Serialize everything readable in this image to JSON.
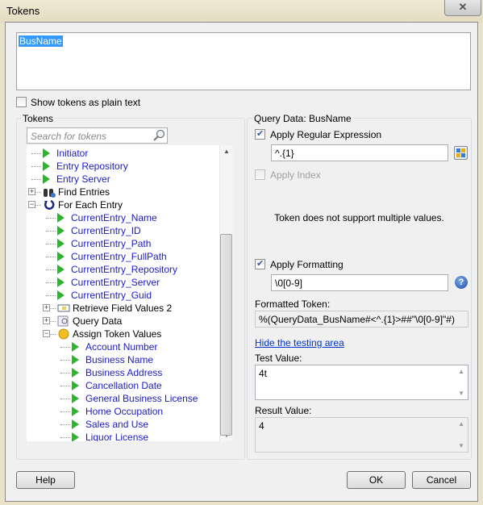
{
  "window": {
    "title": "Tokens",
    "close_icon": "close-icon"
  },
  "editor": {
    "value": "BusName"
  },
  "plain_text": {
    "label": "Show tokens as plain text",
    "checked": false
  },
  "tokens_panel": {
    "title": "Tokens",
    "search_placeholder": "Search for tokens",
    "tree": [
      {
        "label": "Initiator",
        "level": 1,
        "type": "token"
      },
      {
        "label": "Entry Repository",
        "level": 1,
        "type": "token"
      },
      {
        "label": "Entry Server",
        "level": 1,
        "type": "token"
      },
      {
        "label": "Find Entries",
        "level": 1,
        "type": "node",
        "icon": "binoculars-icon",
        "expanded": false
      },
      {
        "label": "For Each Entry",
        "level": 1,
        "type": "node",
        "icon": "loop-icon",
        "expanded": true
      },
      {
        "label": "CurrentEntry_Name",
        "level": 2,
        "type": "token"
      },
      {
        "label": "CurrentEntry_ID",
        "level": 2,
        "type": "token"
      },
      {
        "label": "CurrentEntry_Path",
        "level": 2,
        "type": "token"
      },
      {
        "label": "CurrentEntry_FullPath",
        "level": 2,
        "type": "token"
      },
      {
        "label": "CurrentEntry_Repository",
        "level": 2,
        "type": "token"
      },
      {
        "label": "CurrentEntry_Server",
        "level": 2,
        "type": "token"
      },
      {
        "label": "CurrentEntry_Guid",
        "level": 2,
        "type": "token"
      },
      {
        "label": "Retrieve Field Values 2",
        "level": 2,
        "type": "node",
        "icon": "field-values-icon",
        "expanded": false
      },
      {
        "label": "Query Data",
        "level": 2,
        "type": "node",
        "icon": "query-icon",
        "expanded": false
      },
      {
        "label": "Assign Token Values",
        "level": 2,
        "type": "node",
        "icon": "coin-icon",
        "expanded": true
      },
      {
        "label": "Account Number",
        "level": 3,
        "type": "token"
      },
      {
        "label": "Business Name",
        "level": 3,
        "type": "token"
      },
      {
        "label": "Business Address",
        "level": 3,
        "type": "token"
      },
      {
        "label": "Cancellation Date",
        "level": 3,
        "type": "token"
      },
      {
        "label": "General Business License",
        "level": 3,
        "type": "token"
      },
      {
        "label": "Home Occupation",
        "level": 3,
        "type": "token"
      },
      {
        "label": "Sales and Use",
        "level": 3,
        "type": "token"
      },
      {
        "label": "Liquor License",
        "level": 3,
        "type": "token"
      }
    ]
  },
  "query_panel": {
    "title": "Query Data: BusName",
    "regex": {
      "label": "Apply Regular Expression",
      "checked": true,
      "value": "^.{1}"
    },
    "index": {
      "label": "Apply Index",
      "checked": false,
      "disabled": true,
      "message": "Token does not support multiple values."
    },
    "formatting": {
      "label": "Apply Formatting",
      "checked": true,
      "value": "\\0[0-9]"
    },
    "formatted_label": "Formatted Token:",
    "formatted_value": "%(QueryData_BusName#<^.{1}>##\"\\0[0-9]\"#)",
    "hide_link": "Hide the testing area",
    "test_label": "Test Value:",
    "test_value": "4t",
    "result_label": "Result Value:",
    "result_value": "4"
  },
  "buttons": {
    "help": "Help",
    "ok": "OK",
    "cancel": "Cancel"
  }
}
